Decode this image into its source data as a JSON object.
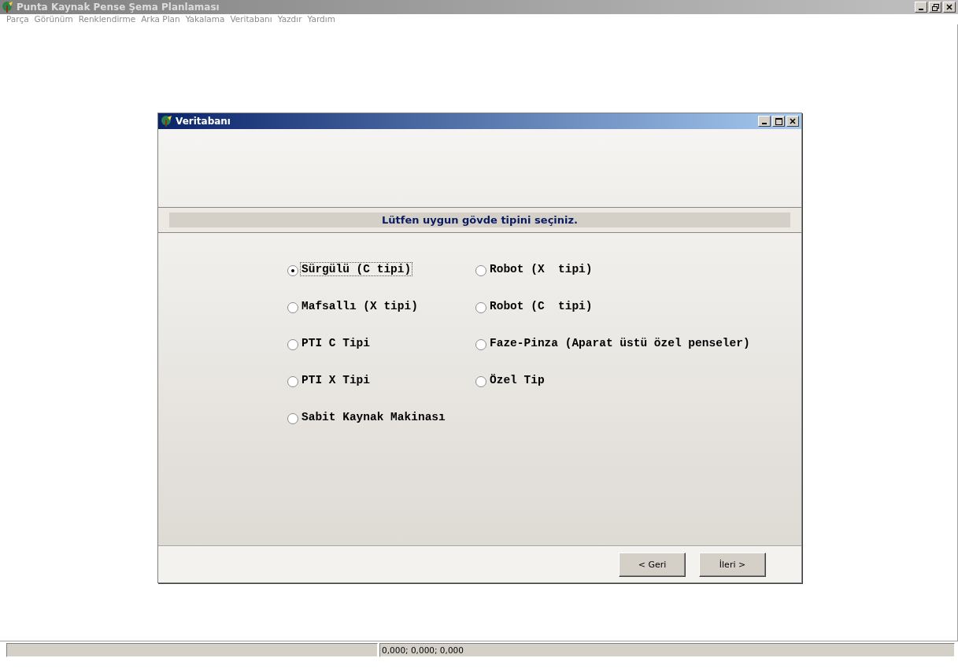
{
  "window": {
    "title": "Punta Kaynak Pense Şema Planlaması"
  },
  "menu": [
    "Parça",
    "Görünüm",
    "Renklendirme",
    "Arka Plan",
    "Yakalama",
    "Veritabanı",
    "Yazdır",
    "Yardım"
  ],
  "dialog": {
    "title": "Veritabanı",
    "heading": "Lütfen uygun gövde tipini seçiniz.",
    "options": [
      {
        "label": "Sürgülü (C tipi)",
        "selected": true,
        "focused": true
      },
      {
        "label": "Mafsallı (X tipi)",
        "selected": false,
        "focused": false
      },
      {
        "label": "PTI C Tipi",
        "selected": false,
        "focused": false
      },
      {
        "label": "PTI X Tipi",
        "selected": false,
        "focused": false
      },
      {
        "label": "Sabit Kaynak Makinası",
        "selected": false,
        "focused": false
      },
      {
        "label": "Robot (X  tipi)",
        "selected": false,
        "focused": false
      },
      {
        "label": "Robot (C  tipi)",
        "selected": false,
        "focused": false
      },
      {
        "label": "Faze-Pinza (Aparat üstü özel penseler)",
        "selected": false,
        "focused": false
      },
      {
        "label": "Özel Tip",
        "selected": false,
        "focused": false
      }
    ],
    "buttons": [
      "< Geri",
      "İleri >"
    ]
  },
  "status_bar": {
    "coordinates": "0,000; 0,000; 0,000"
  }
}
